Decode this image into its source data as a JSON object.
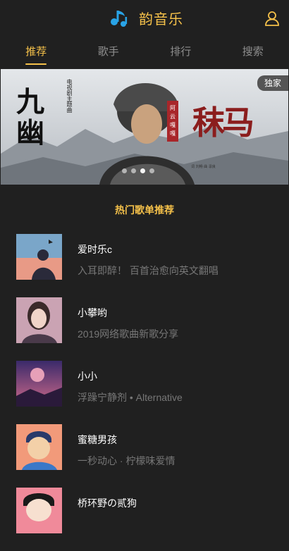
{
  "header": {
    "app_name": "韵音乐",
    "logo_icon": "music-note-icon",
    "user_icon": "user-icon",
    "accent": "#f5c14a"
  },
  "tabs": [
    {
      "label": "推荐",
      "active": true
    },
    {
      "label": "歌手",
      "active": false
    },
    {
      "label": "排行",
      "active": false
    },
    {
      "label": "搜索",
      "active": false
    }
  ],
  "banner": {
    "left_title": "九幽",
    "left_subtitle": "电视剧主题曲",
    "right_title": "秣马",
    "badge": "独家",
    "slide_count": 4,
    "active_slide": 3
  },
  "section": {
    "title": "热门歌单推荐"
  },
  "playlists": [
    {
      "title": "爱时乐c",
      "desc": "入耳即醉！ 百首治愈向英文翻唱"
    },
    {
      "title": "小攀哟",
      "desc": "2019网络歌曲新歌分享"
    },
    {
      "title": "小小",
      "desc": "浮躁宁静剂 • Alternative"
    },
    {
      "title": "蜜糖男孩",
      "desc": "一秒动心 · 柠檬味爱情"
    },
    {
      "title": "桥环野の贰狗",
      "desc": ""
    }
  ]
}
